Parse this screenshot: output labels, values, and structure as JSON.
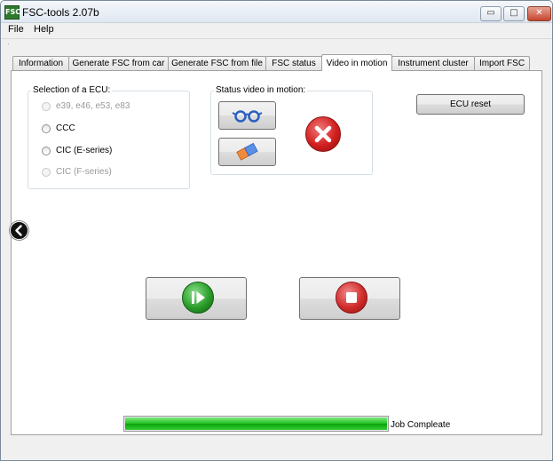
{
  "window": {
    "title": "FSC-tools 2.07b",
    "app_icon_text": "FSC",
    "controls": {
      "minimize": "▭",
      "maximize": "□",
      "close": "✕"
    }
  },
  "menu": {
    "file": "File",
    "help": "Help"
  },
  "tabs": [
    {
      "label": "Information"
    },
    {
      "label": "Generate FSC from car"
    },
    {
      "label": "Generate FSC from file"
    },
    {
      "label": "FSC status"
    },
    {
      "label": "Video in motion"
    },
    {
      "label": "Instrument cluster"
    },
    {
      "label": "Import FSC"
    }
  ],
  "active_tab": "Video in motion",
  "ecu_group": {
    "title": "Selection of a ECU:",
    "options": [
      {
        "label": "e39, e46, e53, e83",
        "enabled": false
      },
      {
        "label": "CCC",
        "enabled": true
      },
      {
        "label": "CIC (E-series)",
        "enabled": true
      },
      {
        "label": "CIC (F-series)",
        "enabled": false
      }
    ]
  },
  "status_group": {
    "title": "Status video in motion:"
  },
  "buttons": {
    "ecu_reset": "ECU reset"
  },
  "progress": {
    "value": 1.0,
    "text": "Job Compleate"
  },
  "icons": {
    "read": "glasses-icon",
    "erase": "eraser-icon",
    "status": "red-x-status-icon",
    "start": "play-pause-icon",
    "stop": "stop-icon",
    "side": "back-arrow-icon"
  },
  "colors": {
    "status_red": "#d21f1f",
    "start_green": "#2a9d2a",
    "stop_red": "#d22b2b",
    "progress_green": "#20c020"
  }
}
